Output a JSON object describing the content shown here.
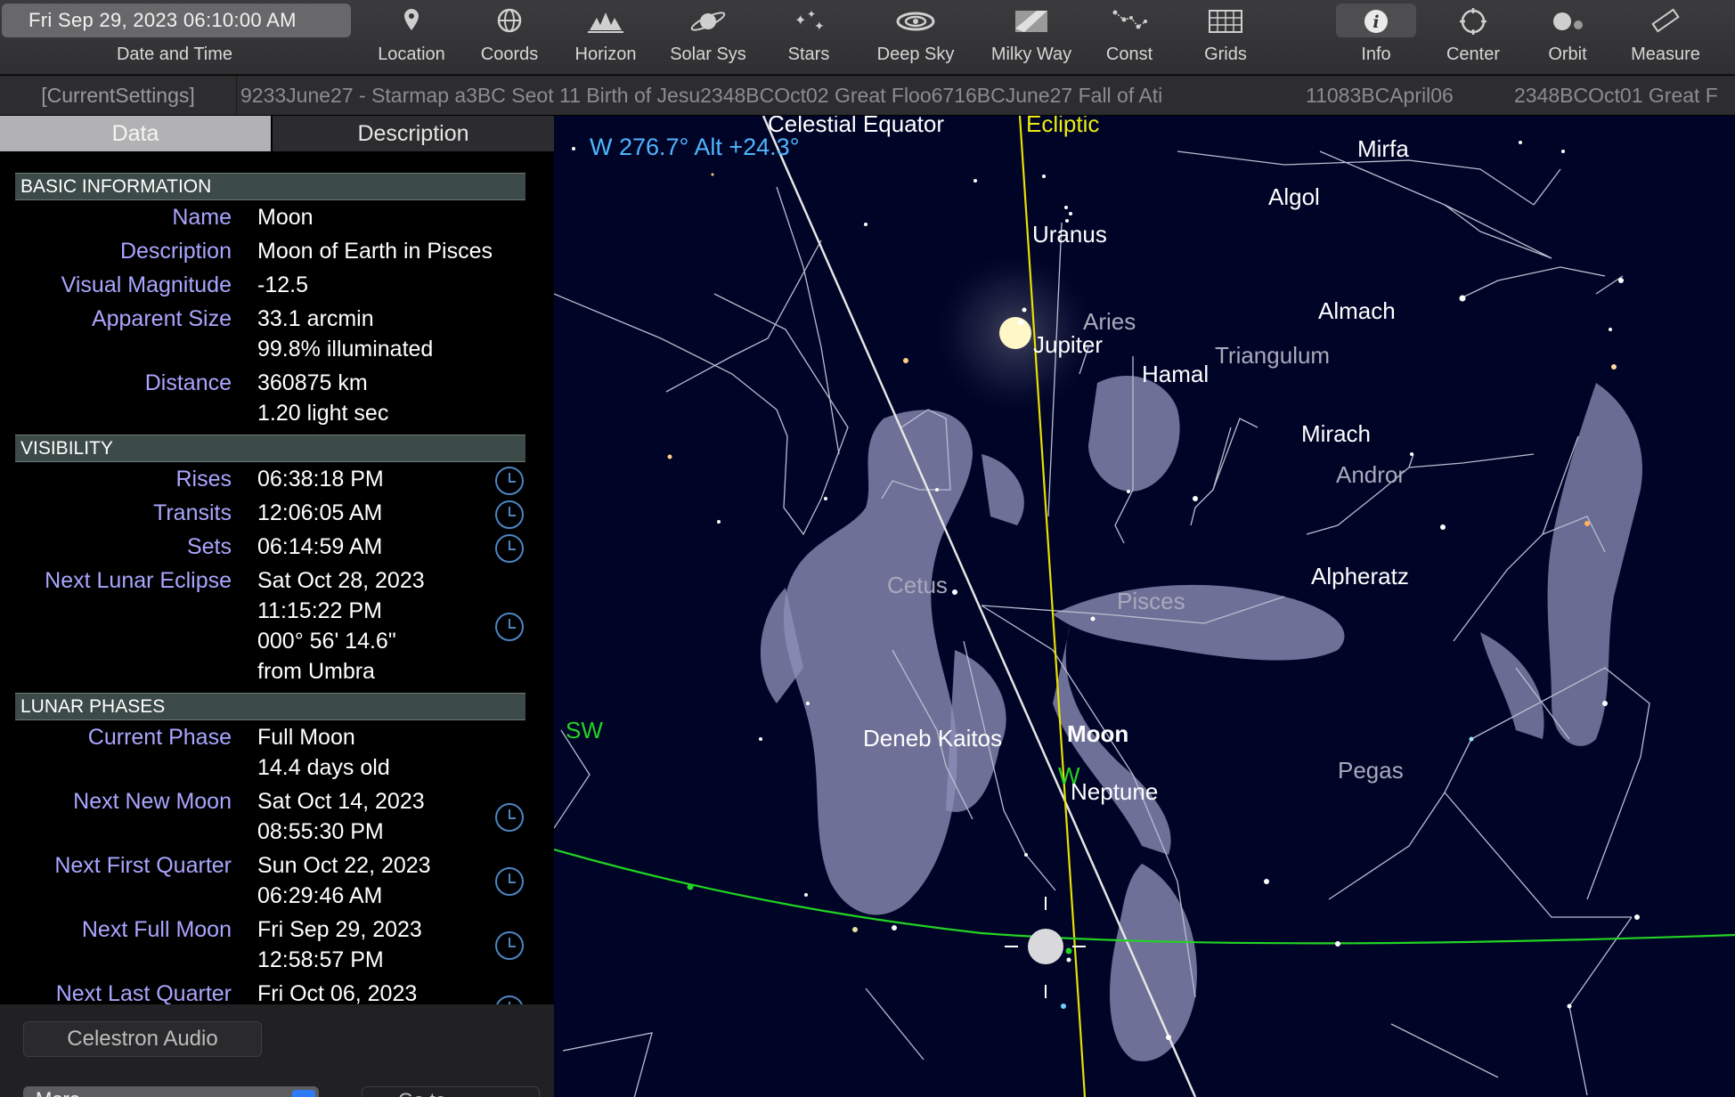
{
  "toolbar": {
    "datetime": "Fri Sep 29, 2023  06:10:00 AM",
    "datetime_label": "Date and Time",
    "items": [
      {
        "label": "Location",
        "icon": "location-pin-icon"
      },
      {
        "label": "Coords",
        "icon": "coords-globe-icon"
      },
      {
        "label": "Horizon",
        "icon": "horizon-icon"
      },
      {
        "label": "Solar Sys",
        "icon": "saturn-icon"
      },
      {
        "label": "Stars",
        "icon": "stars-icon"
      },
      {
        "label": "Deep Sky",
        "icon": "galaxy-icon"
      },
      {
        "label": "Milky Way",
        "icon": "milky-way-icon"
      },
      {
        "label": "Const",
        "icon": "constellation-icon"
      },
      {
        "label": "Grids",
        "icon": "grid-icon"
      },
      {
        "label": "Info",
        "icon": "info-icon",
        "active": true
      },
      {
        "label": "Center",
        "icon": "crosshair-icon"
      },
      {
        "label": "Orbit",
        "icon": "orbit-icon"
      },
      {
        "label": "Measure",
        "icon": "ruler-icon"
      }
    ]
  },
  "settings_bar": {
    "current": "[CurrentSettings]",
    "entry_a": "9233June27 - Starmap a​3BC Seot 11 Birth of Jesu2348BCOct02 Great Floo6716BCJune27 Fall of Ati",
    "entry_b": "11083BCApril06",
    "entry_c": "2348BCOct01 Great F"
  },
  "panel": {
    "tabs": {
      "data": "Data",
      "description": "Description"
    },
    "basic": {
      "header": "BASIC INFORMATION",
      "name_label": "Name",
      "name": "Moon",
      "description_label": "Description",
      "description": "Moon of Earth in Pisces",
      "magnitude_label": "Visual Magnitude",
      "magnitude": "-12.5",
      "size_label": "Apparent Size",
      "size": "33.1 arcmin",
      "illuminated": "99.8% illuminated",
      "distance_label": "Distance",
      "distance_km": "360875 km",
      "distance_ls": "1.20 light sec"
    },
    "visibility": {
      "header": "VISIBILITY",
      "rises_label": "Rises",
      "rises": "06:38:18 PM",
      "transits_label": "Transits",
      "transits": "12:06:05 AM",
      "sets_label": "Sets",
      "sets": "06:14:59 AM",
      "eclipse_label": "Next Lunar Eclipse",
      "eclipse_date": "Sat Oct 28, 2023",
      "eclipse_time": "11:15:22 PM",
      "eclipse_angle": "000° 56' 14.6\"",
      "eclipse_from": "from Umbra"
    },
    "phases": {
      "header": "LUNAR PHASES",
      "current_label": "Current Phase",
      "current": "Full Moon",
      "age": "14.4 days old",
      "new_label": "Next New Moon",
      "new_date": "Sat Oct 14, 2023",
      "new_time": "08:55:30 PM",
      "first_label": "Next First Quarter",
      "first_date": "Sun Oct 22, 2023",
      "first_time": "06:29:46 AM",
      "full_label": "Next Full Moon",
      "full_date": "Fri Sep 29, 2023",
      "full_time": "12:58:57 PM",
      "last_label": "Next Last Quarter",
      "last_date": "Fri Oct 06, 2023"
    },
    "celestron": "Celestron Audio",
    "more_label": "More",
    "other_label": "Go to"
  },
  "sky": {
    "readout": "W 276.7° Alt +24.3°",
    "labels": {
      "celestial_equator": "Celestial Equator",
      "ecliptic": "Ecliptic",
      "uranus": "Uranus",
      "jupiter": "Jupiter",
      "aries": "Aries",
      "hamal": "Hamal",
      "triangulum": "Triangulum",
      "algol": "Algol",
      "mirfak": "Mirfa",
      "almach": "Almach",
      "mirach": "Mirach",
      "andromeda": "Andror",
      "alpheratz": "Alpheratz",
      "cetus": "Cetus",
      "pisces": "Pisces",
      "deneb_kaitos": "Deneb Kaitos",
      "moon": "Moon",
      "neptune": "Neptune",
      "pegasus": "Pegas",
      "sw": "SW",
      "w": "W"
    },
    "colors": {
      "equator": "#e6e6e6",
      "ecliptic": "#e8e000",
      "horizon": "#22d422",
      "readout": "#4fb6ff"
    }
  }
}
